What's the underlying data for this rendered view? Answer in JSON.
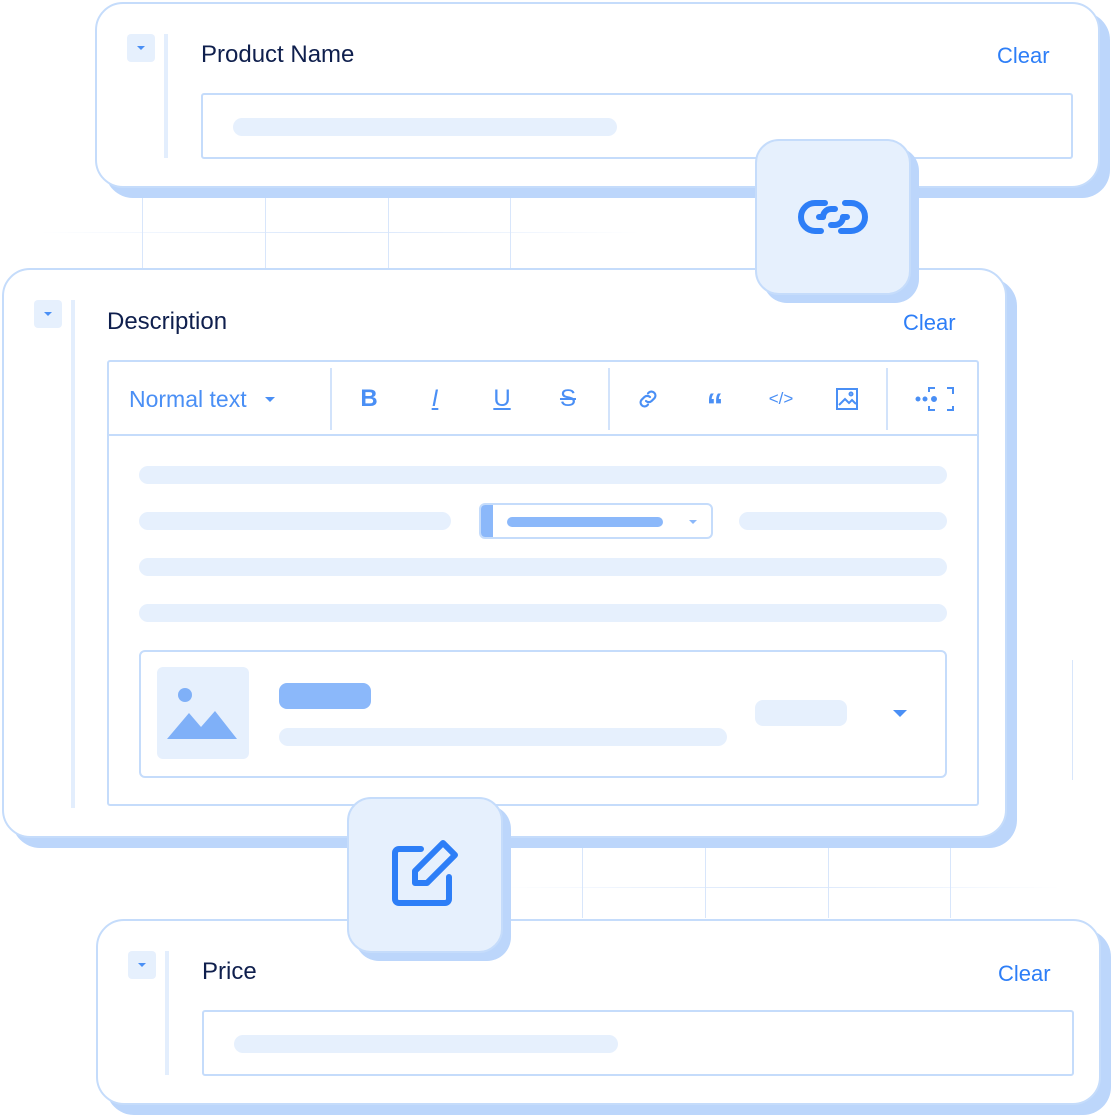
{
  "fields": {
    "product_name": {
      "label": "Product Name",
      "clear": "Clear"
    },
    "description": {
      "label": "Description",
      "clear": "Clear"
    },
    "price": {
      "label": "Price",
      "clear": "Clear"
    }
  },
  "toolbar": {
    "format_select": "Normal text",
    "buttons": [
      "bold-icon",
      "italic-icon",
      "underline-icon",
      "strikethrough-icon",
      "link-icon",
      "quote-icon",
      "code-icon",
      "image-icon",
      "fullscreen-icon"
    ]
  },
  "badges": [
    "link-icon",
    "edit-icon"
  ],
  "colors": {
    "accent": "#2d7ef7",
    "text": "#0f1f4d",
    "light": "#e6f0fd",
    "border": "#c5dcfb"
  }
}
